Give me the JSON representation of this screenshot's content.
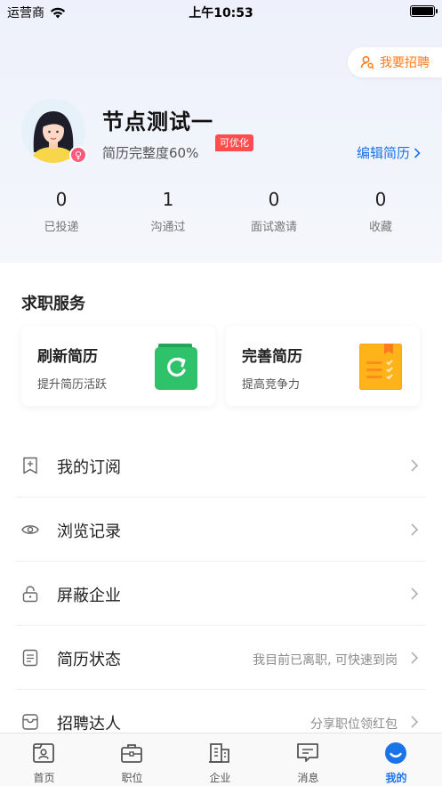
{
  "status_bar": {
    "carrier": "运营商",
    "time": "上午10:53"
  },
  "recruit_button": {
    "label": "我要招聘"
  },
  "profile": {
    "name": "节点测试一",
    "completeness": "简历完整度60%",
    "optimize_tag": "可优化",
    "edit_resume": "编辑简历",
    "gender_icon": "female-icon"
  },
  "stats": [
    {
      "num": "0",
      "label": "已投递"
    },
    {
      "num": "1",
      "label": "沟通过"
    },
    {
      "num": "0",
      "label": "面试邀请"
    },
    {
      "num": "0",
      "label": "收藏"
    }
  ],
  "services": {
    "title": "求职服务",
    "cards": [
      {
        "title": "刷新简历",
        "subtitle": "提升简历活跃",
        "icon": "refresh-icon",
        "color": "#2ec36b"
      },
      {
        "title": "完善简历",
        "subtitle": "提高竞争力",
        "icon": "notebook-icon",
        "color": "#ffb31a"
      }
    ]
  },
  "menu": [
    {
      "label": "我的订阅",
      "extra": "",
      "icon": "bookmark-icon"
    },
    {
      "label": "浏览记录",
      "extra": "",
      "icon": "eye-icon"
    },
    {
      "label": "屏蔽企业",
      "extra": "",
      "icon": "lock-icon"
    },
    {
      "label": "简历状态",
      "extra": "我目前已离职, 可快速到岗",
      "icon": "document-icon"
    },
    {
      "label": "招聘达人",
      "extra": "分享职位领红包",
      "icon": "wallet-icon"
    }
  ],
  "tabbar": [
    {
      "label": "首页",
      "icon": "home-icon",
      "active": false
    },
    {
      "label": "职位",
      "icon": "briefcase-icon",
      "active": false
    },
    {
      "label": "企业",
      "icon": "building-icon",
      "active": false
    },
    {
      "label": "消息",
      "icon": "message-icon",
      "active": false
    },
    {
      "label": "我的",
      "icon": "profile-icon",
      "active": true
    }
  ],
  "colors": {
    "accent": "#1a73e8",
    "orange": "#ff7b1c",
    "tag_red": "#ff4d4f"
  }
}
